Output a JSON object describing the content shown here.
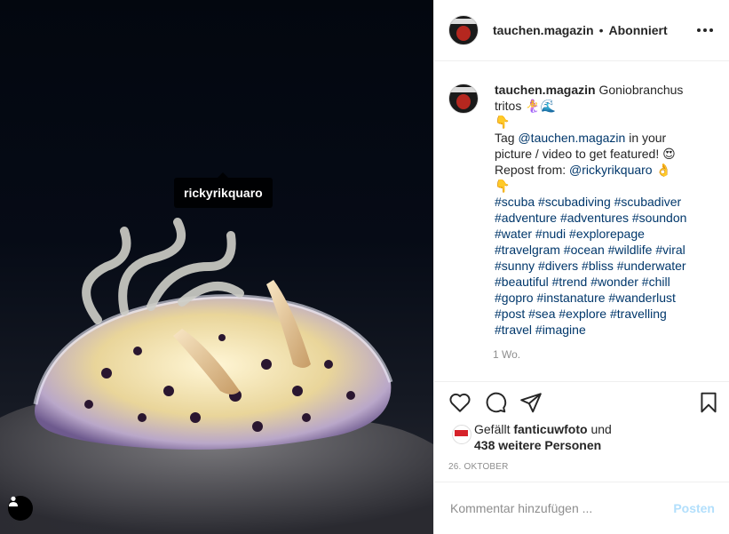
{
  "photo": {
    "tag_username": "rickyrikquaro",
    "user_tag_icon": "person-icon"
  },
  "header": {
    "username": "tauchen.magazin",
    "separator": "•",
    "follow_status": "Abonniert",
    "more_icon": "more-dots-icon"
  },
  "caption": {
    "username": "tauchen.magazin",
    "line1": "Goniobranchus tritos 🧜‍♀️🌊",
    "emoji_point_down": "👇",
    "tag_prefix": "Tag",
    "mention1": "@tauchen.magazin",
    "tag_suffix": "in your picture / video to get featured! 😍",
    "repost_prefix": "Repost from:",
    "mention2": "@rickyrikquaro",
    "emoji_ok": "👌",
    "emoji_point_down2": "👇",
    "hashtags": "#scuba #scubadiving #scubadiver #adventure #adventures #soundon #water #nudi #explorepage #travelgram #ocean #wildlife #viral #sunny #divers #bliss #underwater #beautiful #trend #wonder #chill #gopro #instanature #wanderlust #post #sea #explore #travelling #travel #imagine",
    "time_ago": "1 Wo."
  },
  "actions": {
    "like_icon": "heart-icon",
    "comment_icon": "comment-icon",
    "share_icon": "share-paper-plane-icon",
    "save_icon": "bookmark-icon"
  },
  "likes": {
    "prefix": "Gefällt",
    "user": "fanticuwfoto",
    "and": "und",
    "others": "438 weitere Personen"
  },
  "date": "26. OKTOBER",
  "comment_box": {
    "placeholder": "Kommentar hinzufügen ...",
    "post_label": "Posten"
  }
}
